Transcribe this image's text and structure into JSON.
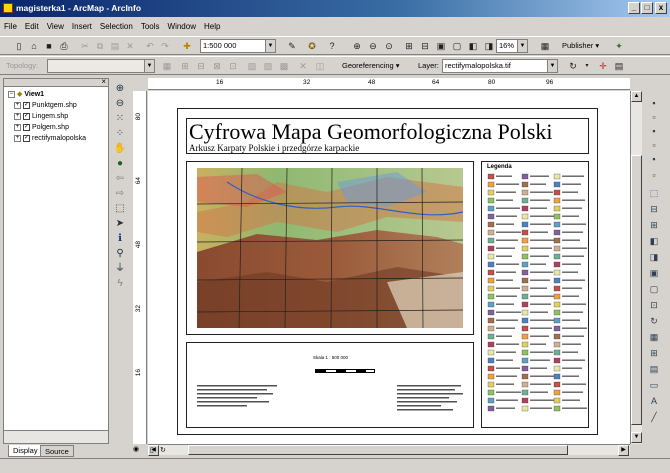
{
  "window": {
    "title": "magisterka1 - ArcMap - ArcInfo",
    "controls": [
      "_",
      "□",
      "x"
    ]
  },
  "menu": [
    "File",
    "Edit",
    "View",
    "Insert",
    "Selection",
    "Tools",
    "Window",
    "Help"
  ],
  "toolbar1": {
    "scale_value": "1:500 000",
    "zoom_value": "16%",
    "publisher_label": "Publisher"
  },
  "toolbar2": {
    "topology_label": "Topology:",
    "georeferencing_label": "Georeferencing",
    "layer_label": "Layer:",
    "layer_value": "rectifymalopolska.tif"
  },
  "toc": {
    "frame": "View1",
    "layers": [
      "Punktgem.shp",
      "Lingem.shp",
      "Polgem.shp",
      "rectifymalopolska"
    ],
    "tabs": [
      "Display",
      "Source"
    ]
  },
  "ruler_top": [
    "16",
    "32",
    "48",
    "64",
    "80",
    "96"
  ],
  "ruler_left": [
    "80",
    "64",
    "48",
    "32",
    "16"
  ],
  "layout": {
    "title": "Cyfrowa Mapa Geomorfologiczna Polski",
    "subtitle": "Arkusz Karpaty Polskie i przedgórze karpackie",
    "legend_title": "Legenda",
    "scale_text": "Skala 1 : 500 000"
  },
  "colors": {
    "titlebar_start": "#0a246a",
    "titlebar_end": "#a6caf0",
    "face": "#d6d3ce"
  }
}
